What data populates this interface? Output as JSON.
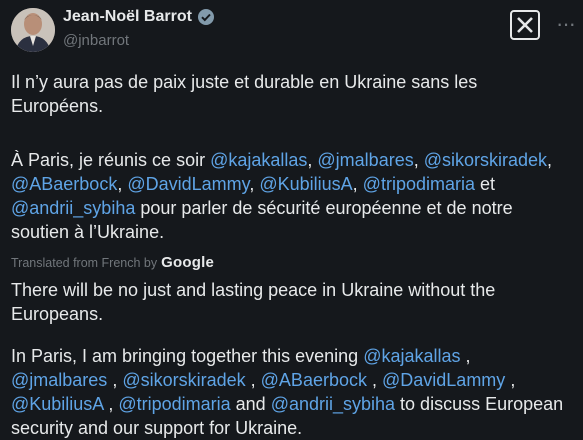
{
  "author": {
    "name": "Jean-Noël Barrot",
    "handle": "@jnbarrot"
  },
  "original": {
    "p1": "Il n’y aura pas de paix juste et durable en Ukraine sans les Européens.",
    "p2_intro": "À Paris, je réunis ce soir ",
    "p2_sep": ", ",
    "p2_and": " et ",
    "p2_tail": " pour parler de sécurité européenne et de notre soutien à l’Ukraine."
  },
  "mentions": [
    "@kajakallas",
    "@jmalbares",
    "@sikorskiradek",
    "@ABaerbock",
    "@DavidLammy",
    "@KubiliusA",
    "@tripodimaria",
    "@andrii_sybiha"
  ],
  "translation": {
    "label": "Translated from French by",
    "provider": "Google",
    "p1": "There will be no just and lasting peace in Ukraine without the Europeans.",
    "p2_intro": "In Paris, I am bringing together this evening ",
    "p2_sep": " , ",
    "p2_and": " and ",
    "p2_tail": " to discuss European security and our support for Ukraine."
  },
  "icons": {
    "verified": "verified-badge-icon",
    "brand": "x-logo-icon",
    "more": "more-options-icon"
  },
  "colors": {
    "background": "#15181c",
    "text": "#e7e9ea",
    "secondary": "#71767b",
    "mention": "#5fa4e6"
  }
}
